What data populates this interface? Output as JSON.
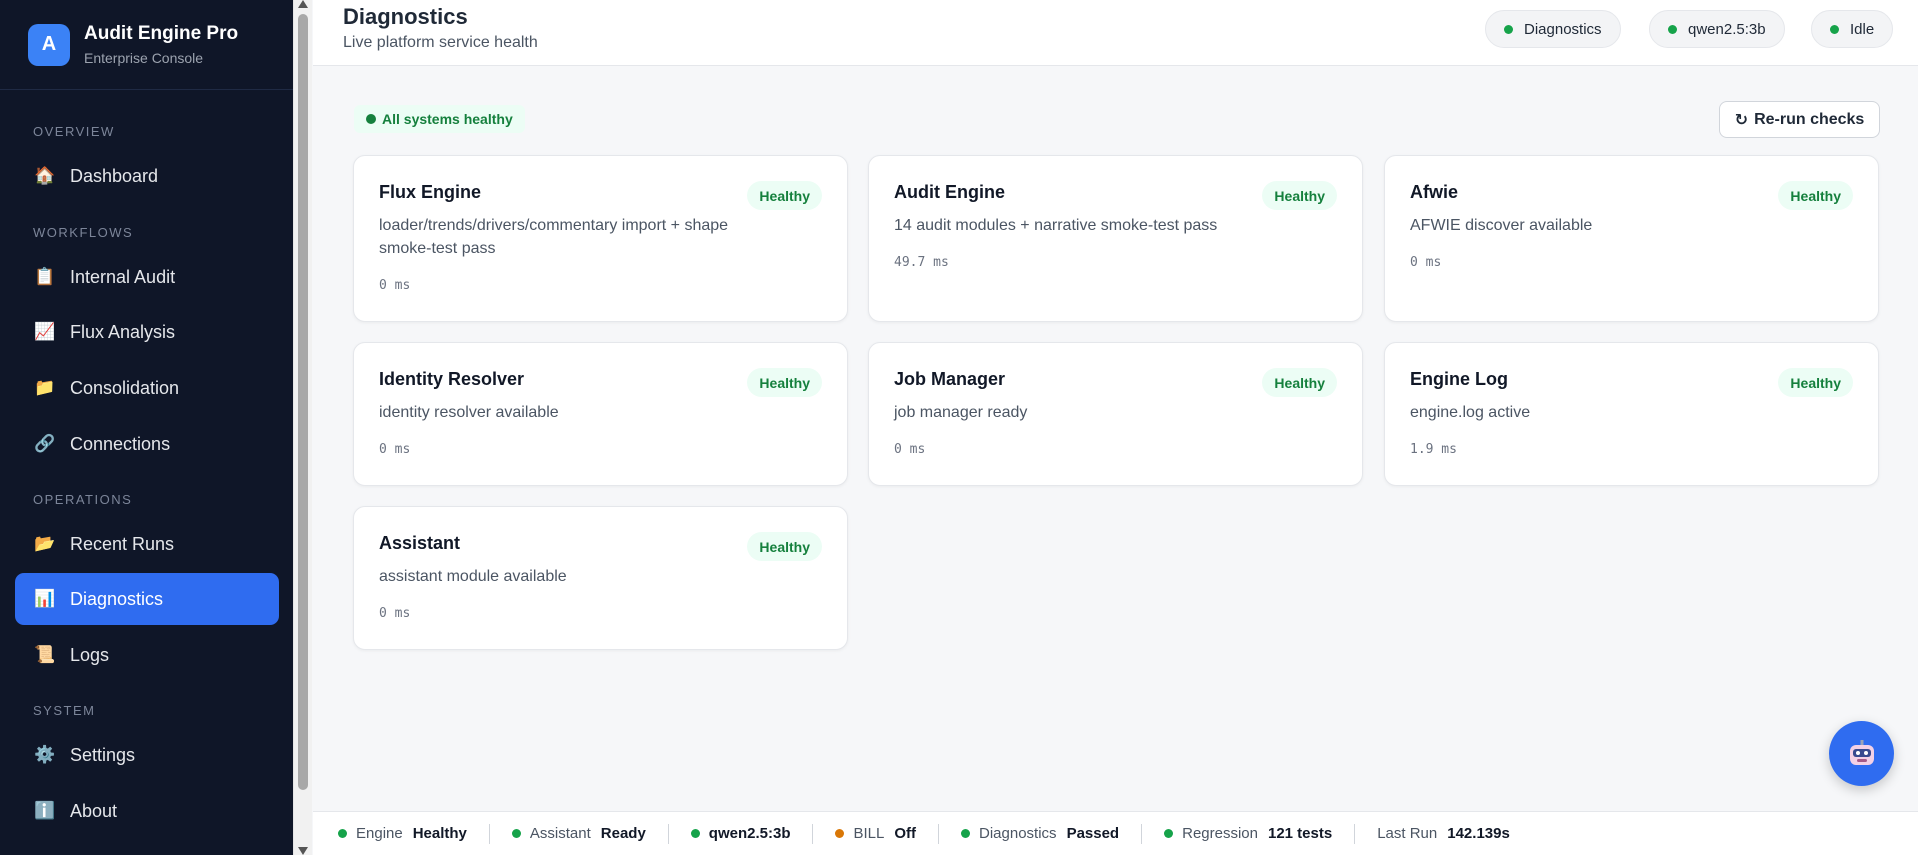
{
  "brand": {
    "logo_letter": "A",
    "title": "Audit Engine Pro",
    "subtitle": "Enterprise Console"
  },
  "sidebar": {
    "sections": [
      "OVERVIEW",
      "WORKFLOWS",
      "OPERATIONS",
      "SYSTEM"
    ],
    "items": [
      {
        "label": "Dashboard",
        "icon": "house-icon"
      },
      {
        "label": "Internal Audit",
        "icon": "clipboard-icon"
      },
      {
        "label": "Flux Analysis",
        "icon": "chart-up-icon"
      },
      {
        "label": "Consolidation",
        "icon": "folder-icon"
      },
      {
        "label": "Connections",
        "icon": "link-icon"
      },
      {
        "label": "Recent Runs",
        "icon": "open-folder-icon"
      },
      {
        "label": "Diagnostics",
        "icon": "bar-chart-icon",
        "active": true
      },
      {
        "label": "Logs",
        "icon": "scroll-icon"
      },
      {
        "label": "Settings",
        "icon": "gear-icon"
      },
      {
        "label": "About",
        "icon": "info-icon"
      }
    ]
  },
  "header": {
    "title": "Diagnostics",
    "subtitle": "Live platform service health",
    "pills": [
      "Diagnostics",
      "qwen2.5:3b",
      "Idle"
    ]
  },
  "main": {
    "status": "All systems healthy",
    "rerun_label": "Re-run checks",
    "cards": [
      {
        "title": "Flux Engine",
        "desc": "loader/trends/drivers/commentary import + shape smoke-test pass",
        "ms": "0 ms",
        "status": "Healthy"
      },
      {
        "title": "Audit Engine",
        "desc": "14 audit modules + narrative smoke-test pass",
        "ms": "49.7 ms",
        "status": "Healthy"
      },
      {
        "title": "Afwie",
        "desc": "AFWIE discover available",
        "ms": "0 ms",
        "status": "Healthy"
      },
      {
        "title": "Identity Resolver",
        "desc": "identity resolver available",
        "ms": "0 ms",
        "status": "Healthy"
      },
      {
        "title": "Job Manager",
        "desc": "job manager ready",
        "ms": "0 ms",
        "status": "Healthy"
      },
      {
        "title": "Engine Log",
        "desc": "engine.log active",
        "ms": "1.9 ms",
        "status": "Healthy"
      },
      {
        "title": "Assistant",
        "desc": "assistant module available",
        "ms": "0 ms",
        "status": "Healthy"
      }
    ]
  },
  "footer": {
    "items": [
      {
        "label": "Engine",
        "value": "Healthy",
        "color": "#16a34a"
      },
      {
        "label": "Assistant",
        "value": "Ready",
        "color": "#16a34a"
      },
      {
        "label": "",
        "value": "qwen2.5:3b",
        "color": "#16a34a"
      },
      {
        "label": "BILL",
        "value": "Off",
        "color": "#d97706"
      },
      {
        "label": "Diagnostics",
        "value": "Passed",
        "color": "#16a34a"
      },
      {
        "label": "Regression",
        "value": "121 tests",
        "color": "#16a34a"
      },
      {
        "label": "Last Run",
        "value": "142.139s",
        "color": ""
      }
    ]
  },
  "colors": {
    "accent": "#2f6cf0",
    "healthy": "#15803d",
    "sidebar_bg": "#0f1628"
  }
}
